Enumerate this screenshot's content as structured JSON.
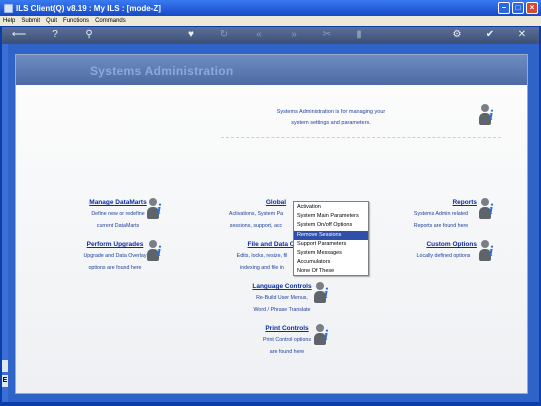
{
  "window": {
    "title": "ILS Client(Q) v8.19 : My ILS :       [mode-Z]"
  },
  "menu": [
    "Help",
    "Submit",
    "Quit",
    "Functions",
    "Commands"
  ],
  "toolbar": {
    "icons": [
      "back-arrow-icon",
      "help-icon",
      "search-icon",
      "heart-icon",
      "refresh-icon",
      "rewind-icon",
      "fast-forward-icon",
      "tools-icon",
      "print-icon",
      "settings-icon",
      "check-icon",
      "close-icon"
    ]
  },
  "sidebar": {
    "tab_bottom_label": "E"
  },
  "page": {
    "title": "Systems Administration",
    "intro_line1": "Systems Administration is for managing your",
    "intro_line2": "system settings and parameters."
  },
  "sections": {
    "manage_datamarts": {
      "title": "Manage DataMarts",
      "desc1": "Define new or redefine",
      "desc2": "current DataMarts"
    },
    "global": {
      "title": "Global",
      "desc1": "Activations, System Pa",
      "desc2": "sessions, support, acc"
    },
    "reports": {
      "title": "Reports",
      "desc1": "Systems Admin related",
      "desc2": "Reports are found here"
    },
    "perform_upgrades": {
      "title": "Perform Upgrades",
      "desc1": "Upgrade and Data Overlay",
      "desc2": "options are found here"
    },
    "file_data": {
      "title": "File and Data C",
      "desc1": "Edits, locks, resize, fil",
      "desc2": "indexing and file in"
    },
    "custom_options": {
      "title": "Custom Options",
      "desc1": "Locally defined options"
    },
    "language_controls": {
      "title": "Language Controls",
      "desc1": "Re-Build User Menus,",
      "desc2": "Word / Phrase Translate"
    },
    "print_controls": {
      "title": "Print Controls",
      "desc1": "Print Control options",
      "desc2": "are found here"
    }
  },
  "context_menu": {
    "items": [
      "Activation",
      "System Main Parameters",
      "System On/off Options",
      "Remove Sessions",
      "Support Parameters",
      "System Messages",
      "Accumulators",
      "None Of These"
    ],
    "selected": "Remove Sessions"
  }
}
